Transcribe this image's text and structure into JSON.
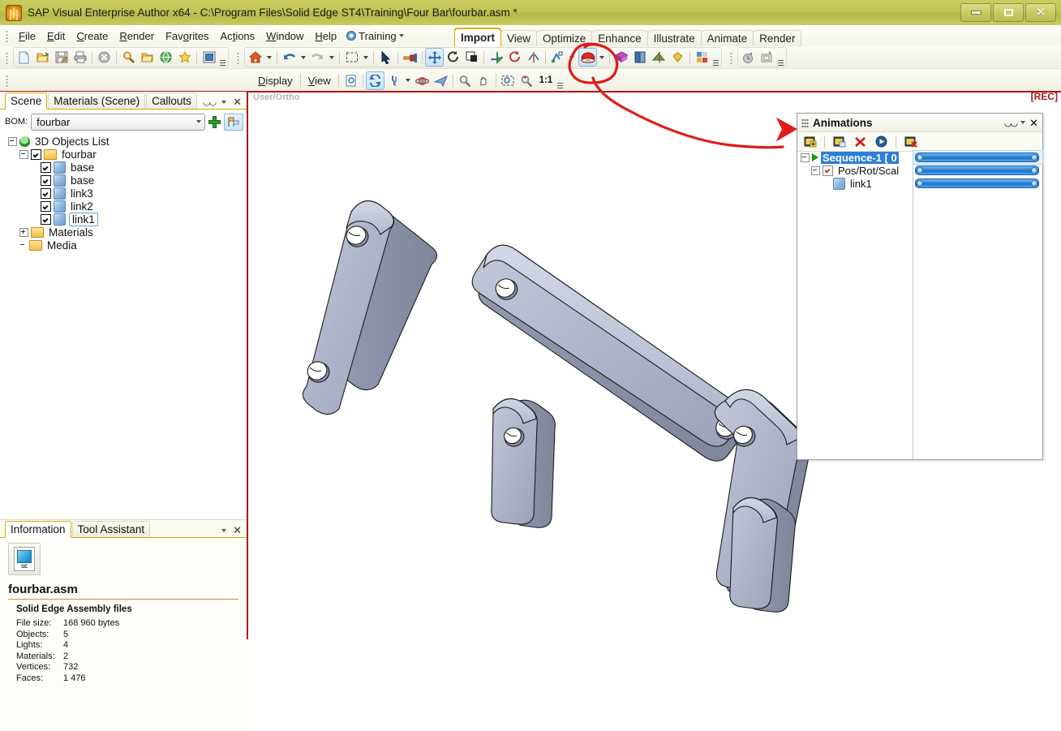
{
  "window": {
    "title": "SAP Visual Enterprise Author x64 - C:\\Program Files\\Solid Edge ST4\\Training\\Four Bar\\fourbar.asm *",
    "app_icon": "sap-logo-icon",
    "minimize": "minimize-icon",
    "maximize": "maximize-icon",
    "close": "close-icon",
    "titlebar_color": "#c2c656"
  },
  "menubar": {
    "items": [
      "File",
      "Edit",
      "Create",
      "Render",
      "Favorites",
      "Actions",
      "Window",
      "Help"
    ],
    "training": "Training"
  },
  "ribbon": {
    "tabs": [
      {
        "label": "Import",
        "active": true
      },
      {
        "label": "View",
        "active": false
      },
      {
        "label": "Optimize",
        "active": false
      },
      {
        "label": "Enhance",
        "active": false
      },
      {
        "label": "Illustrate",
        "active": false
      },
      {
        "label": "Animate",
        "active": false
      },
      {
        "label": "Render",
        "active": false
      }
    ],
    "active_tab_accent": "#e0a800"
  },
  "toolbar_main": {
    "groups": [
      {
        "buttons": [
          "new-document-icon",
          "open-folder-icon",
          "save-icon",
          "print-icon",
          "sep",
          "stop-icon",
          "sep",
          "search-icon",
          "browse-folder-icon",
          "globe-icon",
          "favorites-star-icon",
          "sep",
          "fullscreen-icon"
        ],
        "overflow": true
      },
      {
        "buttons": [
          "home-icon",
          "dropdown-caret",
          "sep",
          "undo-icon",
          "dropdown-caret",
          "redo-icon",
          "dropdown-caret",
          "sep",
          "select-rectangle-icon",
          "dropdown-caret",
          "sep",
          "arrow-cursor-icon",
          "sep",
          "paint-icon",
          "sep",
          "move-icon",
          "rotate-icon",
          "scale-icon",
          "sep",
          "align-move-icon",
          "align-rotate-icon",
          "align-mirror-icon",
          "sep",
          "pivot-icon",
          "dropdown-caret",
          "animation-record-icon",
          "dropdown-caret",
          "sep",
          "material-icon",
          "book-icon",
          "texture-icon",
          "gem-icon",
          "sep",
          "layout-grid-icon"
        ],
        "overflow": true
      },
      {
        "buttons": [
          "camera-clock-icon",
          "snapshot-icon"
        ],
        "overflow": true
      }
    ]
  },
  "toolbar_view": {
    "display_label": "Display",
    "view_label": "View",
    "ratio_label": "1:1",
    "buttons": [
      "page-preview-icon",
      "sep",
      "turntable-icon",
      "walk-icon",
      "dropdown-caret",
      "orbit-icon",
      "fly-icon",
      "sep",
      "zoom-icon",
      "pan-icon",
      "sep",
      "zoom-window-icon",
      "zoom-fit-icon"
    ]
  },
  "left_dock": {
    "tabs": [
      {
        "label": "Scene",
        "active": true
      },
      {
        "label": "Materials (Scene)",
        "active": false
      },
      {
        "label": "Callouts",
        "active": false
      }
    ],
    "tools": [
      "find-icon",
      "chevron-down-icon",
      "close-icon"
    ],
    "bom": {
      "label": "BOM:",
      "value": "fourbar",
      "add_button": "add-plus-icon",
      "flag_button": "bom-flag-icon"
    },
    "tree": [
      {
        "depth": 0,
        "expander": "minus",
        "icon": "scene-bulb-icon",
        "checkbox": null,
        "label": "3D Objects List",
        "selected": false
      },
      {
        "depth": 1,
        "expander": "minus",
        "icon": "folder-icon",
        "checkbox": "checked",
        "label": "fourbar",
        "selected": false
      },
      {
        "depth": 2,
        "expander": "none",
        "icon": "cube-icon",
        "checkbox": "checked",
        "label": "base",
        "selected": false
      },
      {
        "depth": 2,
        "expander": "none",
        "icon": "cube-icon",
        "checkbox": "checked",
        "label": "base",
        "selected": false
      },
      {
        "depth": 2,
        "expander": "none",
        "icon": "cube-icon",
        "checkbox": "checked",
        "label": "link3",
        "selected": false
      },
      {
        "depth": 2,
        "expander": "none",
        "icon": "cube-icon",
        "checkbox": "checked",
        "label": "link2",
        "selected": false
      },
      {
        "depth": 2,
        "expander": "none",
        "icon": "cube-icon",
        "checkbox": "checked",
        "label": "link1",
        "selected": true
      },
      {
        "depth": 1,
        "expander": "plus",
        "icon": "folder-icon",
        "checkbox": null,
        "label": "Materials",
        "selected": false
      },
      {
        "depth": 1,
        "expander": "none",
        "icon": "folder-icon",
        "checkbox": null,
        "label": "Media",
        "selected": false
      }
    ]
  },
  "info_panel": {
    "tabs": [
      {
        "label": "Information",
        "active": true
      },
      {
        "label": "Tool Assistant",
        "active": false
      }
    ],
    "tools": [
      "chevron-down-icon",
      "close-icon"
    ],
    "file_icon": "solid-edge-file-icon",
    "filename": "fourbar.asm",
    "category": "Solid Edge Assembly files",
    "properties": [
      {
        "key": "File size:",
        "value": "168 960 bytes"
      },
      {
        "key": "Objects:",
        "value": "5"
      },
      {
        "key": "Lights:",
        "value": "4"
      },
      {
        "key": "Materials:",
        "value": "2"
      },
      {
        "key": "Vertices:",
        "value": "732"
      },
      {
        "key": "Faces:",
        "value": "1 476"
      }
    ]
  },
  "viewport": {
    "view_label": "User/Ortho",
    "rec_label": "[REC]",
    "rec_color": "#a81b1b",
    "part_color": "#a8aec4",
    "background": "#ffffff"
  },
  "animations_panel": {
    "title": "Animations",
    "grip": "drag-grip-icon",
    "header_tools": [
      "find-icon",
      "chevron-down-icon",
      "close-icon"
    ],
    "toolbar": [
      "new-animation-icon",
      "sep",
      "add-track-icon",
      "delete-icon",
      "play-icon",
      "sep",
      "delete-animation-icon"
    ],
    "rows": [
      {
        "depth": 0,
        "expander": "minus",
        "icon": "play-triangle-icon",
        "checkbox": null,
        "label": "Sequence-1 [ 0",
        "selected": true
      },
      {
        "depth": 1,
        "expander": "minus",
        "icon": null,
        "checkbox": "red-check",
        "label": "Pos/Rot/Scal",
        "selected": false
      },
      {
        "depth": 2,
        "expander": "none",
        "icon": "cube-icon",
        "checkbox": null,
        "label": "link1",
        "selected": false
      }
    ],
    "timeline_bar_color": "#2f86dc"
  },
  "annotation": {
    "color": "#e01b1b",
    "circle_target": "animation-record-icon",
    "arrow_target": "animations-panel"
  }
}
